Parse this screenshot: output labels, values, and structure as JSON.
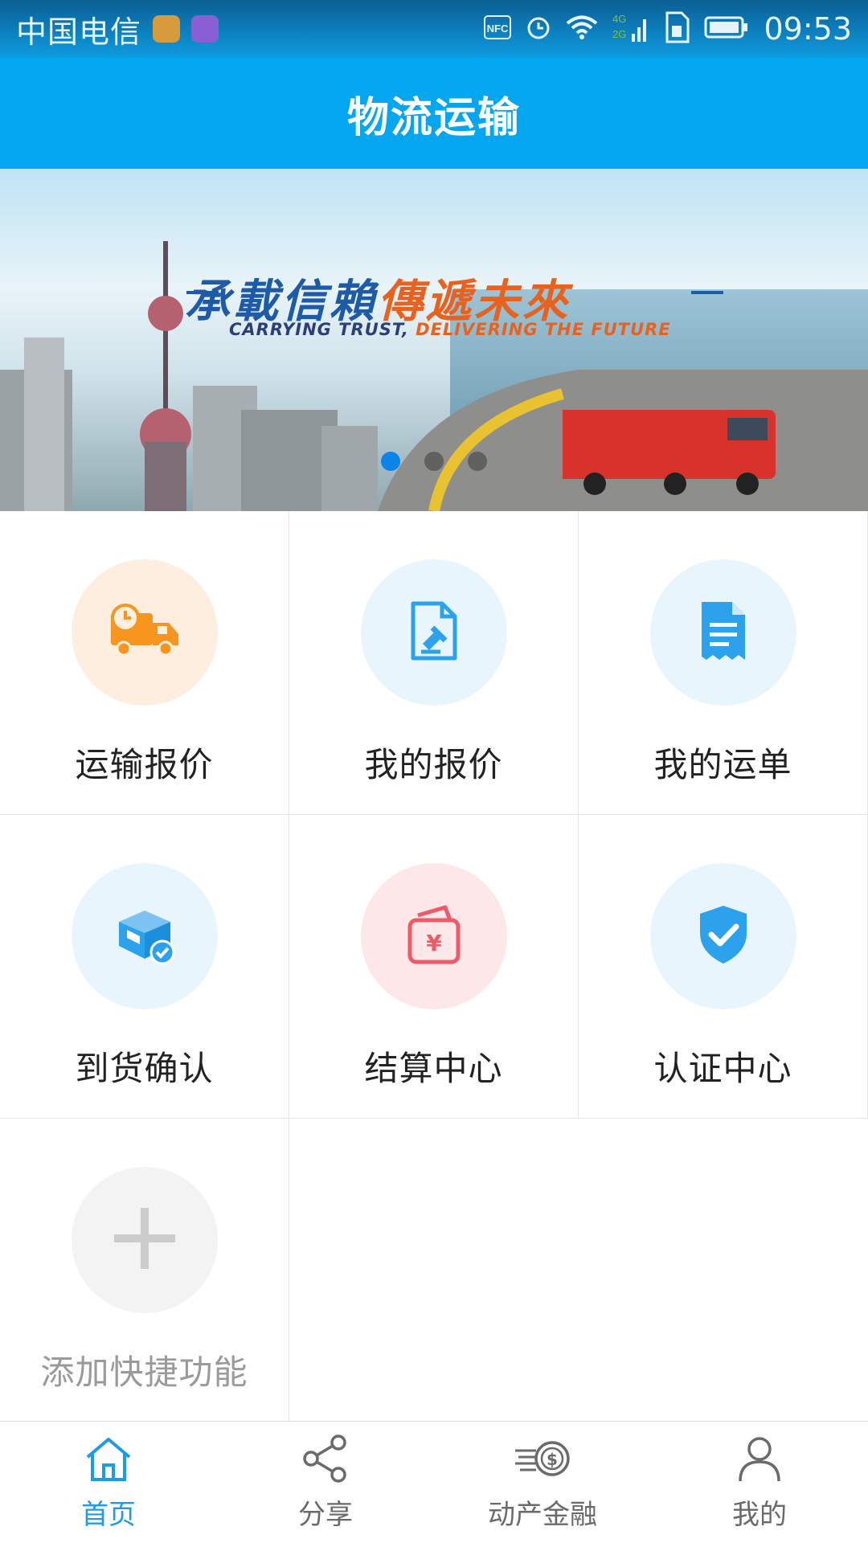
{
  "status_bar": {
    "carrier": "中国电信",
    "network": "4G 2G",
    "time": "09:53",
    "icons": [
      "health-app-icon",
      "gallery-app-icon",
      "nfc-icon",
      "alarm-icon",
      "wifi-icon",
      "signal-icon",
      "sim-icon",
      "battery-icon"
    ]
  },
  "header": {
    "title": "物流运输"
  },
  "banner": {
    "slogan_cn_part1": "承載信賴",
    "slogan_cn_part2": "傳遞未來",
    "slogan_en_part1": "CARRYING TRUST,",
    "slogan_en_part2": " DELIVERING THE FUTURE",
    "slides": 3,
    "active_slide": 1
  },
  "grid": {
    "items": [
      {
        "label": "运输报价",
        "icon": "delivery-truck-icon",
        "bg": "#fdeee0",
        "color": "#f7961e"
      },
      {
        "label": "我的报价",
        "icon": "quote-document-icon",
        "bg": "#e9f5fd",
        "color": "#2da2ec"
      },
      {
        "label": "我的运单",
        "icon": "waybill-icon",
        "bg": "#e9f5fd",
        "color": "#2da2ec"
      },
      {
        "label": "到货确认",
        "icon": "package-check-icon",
        "bg": "#e9f5fd",
        "color": "#2da2ec"
      },
      {
        "label": "结算中心",
        "icon": "settlement-wallet-icon",
        "bg": "#fde7e9",
        "color": "#ef5a68"
      },
      {
        "label": "认证中心",
        "icon": "shield-check-icon",
        "bg": "#e9f5fd",
        "color": "#2da2ec"
      },
      {
        "label": "添加快捷功能",
        "icon": "plus-icon",
        "bg": "#f3f3f3",
        "color": "#cccccc"
      }
    ]
  },
  "tabbar": {
    "tabs": [
      {
        "label": "首页",
        "icon": "home-icon",
        "active": true
      },
      {
        "label": "分享",
        "icon": "share-icon",
        "active": false
      },
      {
        "label": "动产金融",
        "icon": "finance-coin-icon",
        "active": false
      },
      {
        "label": "我的",
        "icon": "user-icon",
        "active": false
      }
    ],
    "active_color": "#1a9ce6",
    "inactive_color": "#6a6a6a"
  }
}
